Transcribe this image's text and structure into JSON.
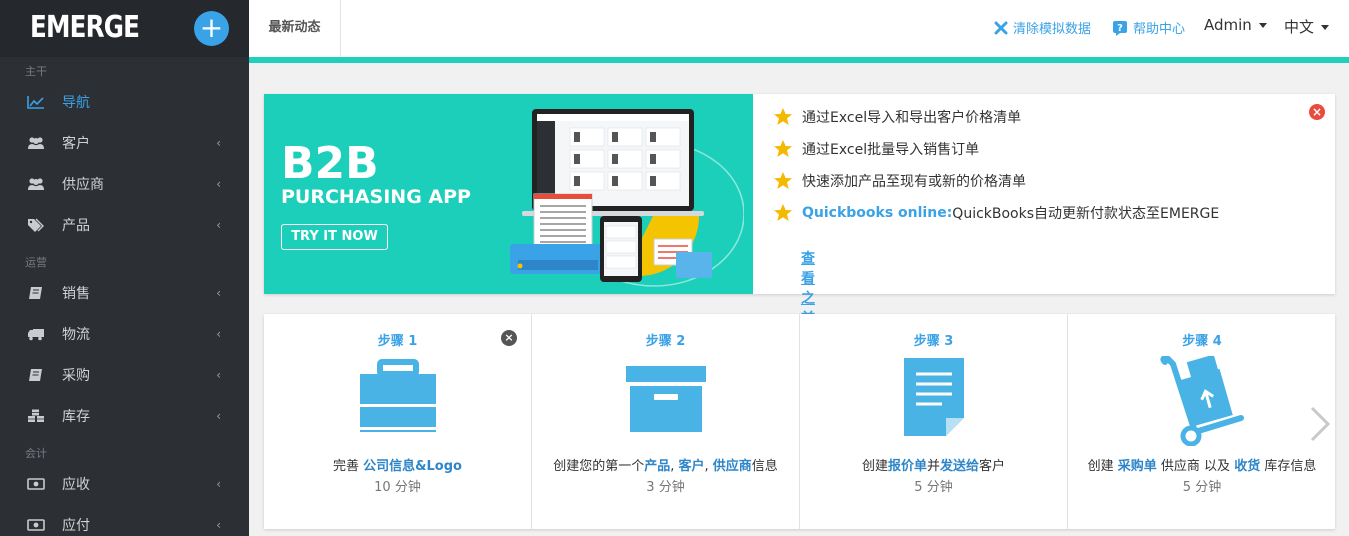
{
  "app": {
    "logo": "EMERGE",
    "add_label": "+"
  },
  "sidebar": {
    "sections": [
      "主干",
      "运营",
      "会计"
    ],
    "items": [
      {
        "label": "导航",
        "icon": "chart-line-icon",
        "active": true,
        "has_caret": false
      },
      {
        "label": "客户",
        "icon": "users-icon",
        "has_caret": true
      },
      {
        "label": "供应商",
        "icon": "users-icon",
        "has_caret": true
      },
      {
        "label": "产品",
        "icon": "tags-icon",
        "has_caret": true
      },
      {
        "label": "销售",
        "icon": "book-icon",
        "has_caret": true
      },
      {
        "label": "物流",
        "icon": "truck-icon",
        "has_caret": true
      },
      {
        "label": "采购",
        "icon": "book-icon",
        "has_caret": true
      },
      {
        "label": "库存",
        "icon": "cubes-icon",
        "has_caret": true
      },
      {
        "label": "应收",
        "icon": "money-icon",
        "has_caret": true
      },
      {
        "label": "应付",
        "icon": "money-icon",
        "has_caret": true
      }
    ],
    "caret": "‹"
  },
  "topbar": {
    "tab": "最新动态",
    "clear_label": "清除模拟数据",
    "help_label": "帮助中心",
    "user_label": "Admin",
    "lang_label": "中文"
  },
  "banner": {
    "ad_title": "B2B",
    "ad_subtitle": "PURCHASING APP",
    "ad_button": "TRY IT NOW",
    "updates": [
      {
        "text": "通过Excel导入和导出客户价格清单"
      },
      {
        "text": "通过Excel批量导入销售订单"
      },
      {
        "text": "快速添加产品至现有或新的价格清单"
      },
      {
        "prefix": "Quickbooks online:",
        "text": "QuickBooks自动更新付款状态至EMERGE"
      }
    ],
    "see_more": "查看之前的更新"
  },
  "steps": [
    {
      "title": "步骤 1",
      "desc_parts": [
        [
          "完善 ",
          false
        ],
        [
          "公司信息&Logo",
          true
        ]
      ],
      "time": "10 分钟",
      "icon": "briefcase-icon"
    },
    {
      "title": "步骤 2",
      "desc_parts": [
        [
          "创建您的第一个",
          false
        ],
        [
          "产品",
          true
        ],
        [
          ", ",
          false
        ],
        [
          "客户",
          true
        ],
        [
          ", ",
          false
        ],
        [
          "供应商",
          true
        ],
        [
          "信息",
          false
        ]
      ],
      "time": "3 分钟",
      "icon": "archive-box-icon"
    },
    {
      "title": "步骤 3",
      "desc_parts": [
        [
          "创建",
          false
        ],
        [
          "报价单",
          true
        ],
        [
          "并",
          false
        ],
        [
          "发送给",
          true
        ],
        [
          "客户",
          false
        ]
      ],
      "time": "5 分钟",
      "icon": "document-icon"
    },
    {
      "title": "步骤 4",
      "desc_parts": [
        [
          "创建 ",
          false
        ],
        [
          "采购单",
          true
        ],
        [
          " 供应商 以及 ",
          false
        ],
        [
          "收货",
          true
        ],
        [
          " 库存信息",
          false
        ]
      ],
      "time": "5 分钟",
      "icon": "hand-truck-icon"
    }
  ],
  "colors": {
    "accent": "#3aa2e6",
    "teal": "#1ccfbb",
    "sidebar": "#2c2f33",
    "star": "#f5b900"
  }
}
